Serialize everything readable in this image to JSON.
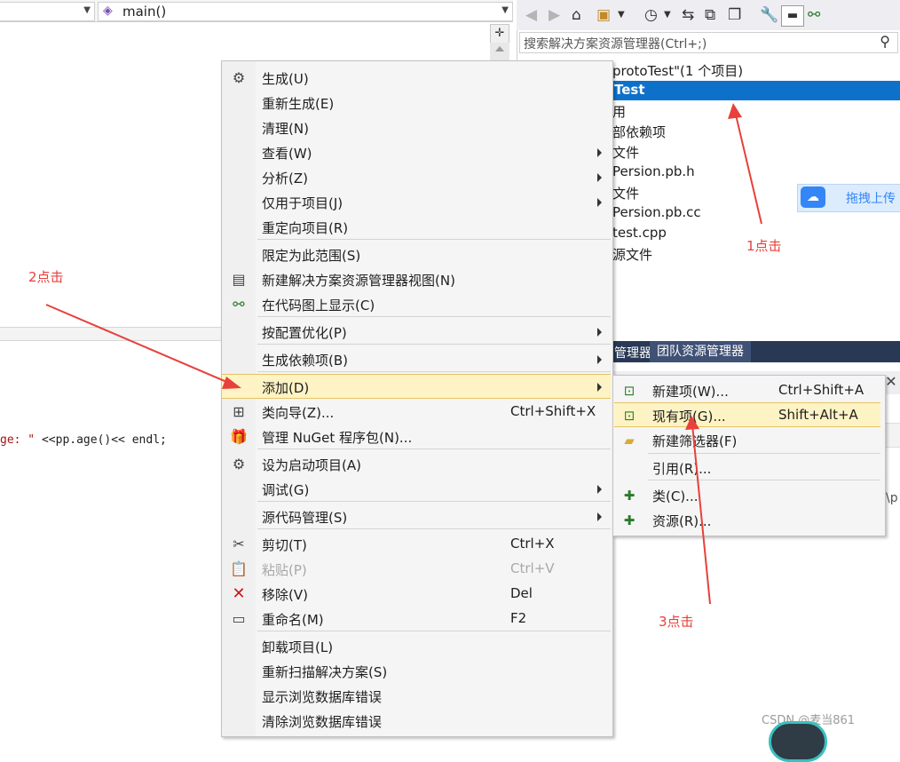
{
  "editor": {
    "nav_right_value": "main()",
    "code_string": "ge: \"",
    "code_rest": " <<pp.age()<< endl;"
  },
  "solution_explorer": {
    "search_placeholder": "搜索解决方案资源管理器(Ctrl+;)",
    "tree": [
      "protoTest\"(1 个项目)",
      "Test",
      "用",
      "部依赖项",
      "文件",
      "Persion.pb.h",
      "文件",
      "Persion.pb.cc",
      "test.cpp",
      "源文件"
    ],
    "tabs": [
      "管理器",
      "团队资源管理器"
    ],
    "clipped_text": "\\p"
  },
  "baidu_overlay": {
    "label": "拖拽上传"
  },
  "context_menu": {
    "items": [
      {
        "label": "生成(U)",
        "icon": "build-icon"
      },
      {
        "label": "重新生成(E)"
      },
      {
        "label": "清理(N)"
      },
      {
        "label": "查看(W)",
        "submenu": true
      },
      {
        "label": "分析(Z)",
        "submenu": true
      },
      {
        "label": "仅用于项目(J)",
        "submenu": true
      },
      {
        "label": "重定向项目(R)"
      },
      {
        "label": "限定为此范围(S)"
      },
      {
        "label": "新建解决方案资源管理器视图(N)",
        "icon": "new-view-icon"
      },
      {
        "label": "在代码图上显示(C)",
        "icon": "code-map-icon"
      },
      {
        "label": "按配置优化(P)",
        "submenu": true
      },
      {
        "label": "生成依赖项(B)",
        "submenu": true
      },
      {
        "label": "添加(D)",
        "submenu": true,
        "highlighted": true
      },
      {
        "label": "类向导(Z)...",
        "shortcut": "Ctrl+Shift+X",
        "icon": "class-wizard-icon"
      },
      {
        "label": "管理 NuGet 程序包(N)...",
        "icon": "nuget-icon"
      },
      {
        "label": "设为启动项目(A)",
        "icon": "gear-icon"
      },
      {
        "label": "调试(G)",
        "submenu": true
      },
      {
        "label": "源代码管理(S)",
        "submenu": true
      },
      {
        "label": "剪切(T)",
        "shortcut": "Ctrl+X",
        "icon": "scissors-icon"
      },
      {
        "label": "粘贴(P)",
        "shortcut": "Ctrl+V",
        "icon": "paste-icon",
        "disabled": true
      },
      {
        "label": "移除(V)",
        "shortcut": "Del",
        "icon": "remove-icon"
      },
      {
        "label": "重命名(M)",
        "shortcut": "F2",
        "icon": "rename-icon"
      },
      {
        "label": "卸载项目(L)"
      },
      {
        "label": "重新扫描解决方案(S)"
      },
      {
        "label": "显示浏览数据库错误"
      },
      {
        "label": "清除浏览数据库错误"
      }
    ]
  },
  "add_submenu": {
    "items": [
      {
        "label": "新建项(W)...",
        "shortcut": "Ctrl+Shift+A"
      },
      {
        "label": "现有项(G)...",
        "shortcut": "Shift+Alt+A",
        "highlighted": true
      },
      {
        "label": "新建筛选器(F)"
      },
      {
        "label": "引用(R)..."
      },
      {
        "label": "类(C)..."
      },
      {
        "label": "资源(R)..."
      }
    ]
  },
  "annotations": {
    "step1": "1点击",
    "step2": "2点击",
    "step3": "3点击"
  },
  "watermark": "CSDN @麦当861",
  "colors": {
    "selection_blue": "#0e71c9",
    "menu_highlight": "#fdf3c4",
    "annotation_red": "#e8403b",
    "tab_bar": "#293955"
  }
}
